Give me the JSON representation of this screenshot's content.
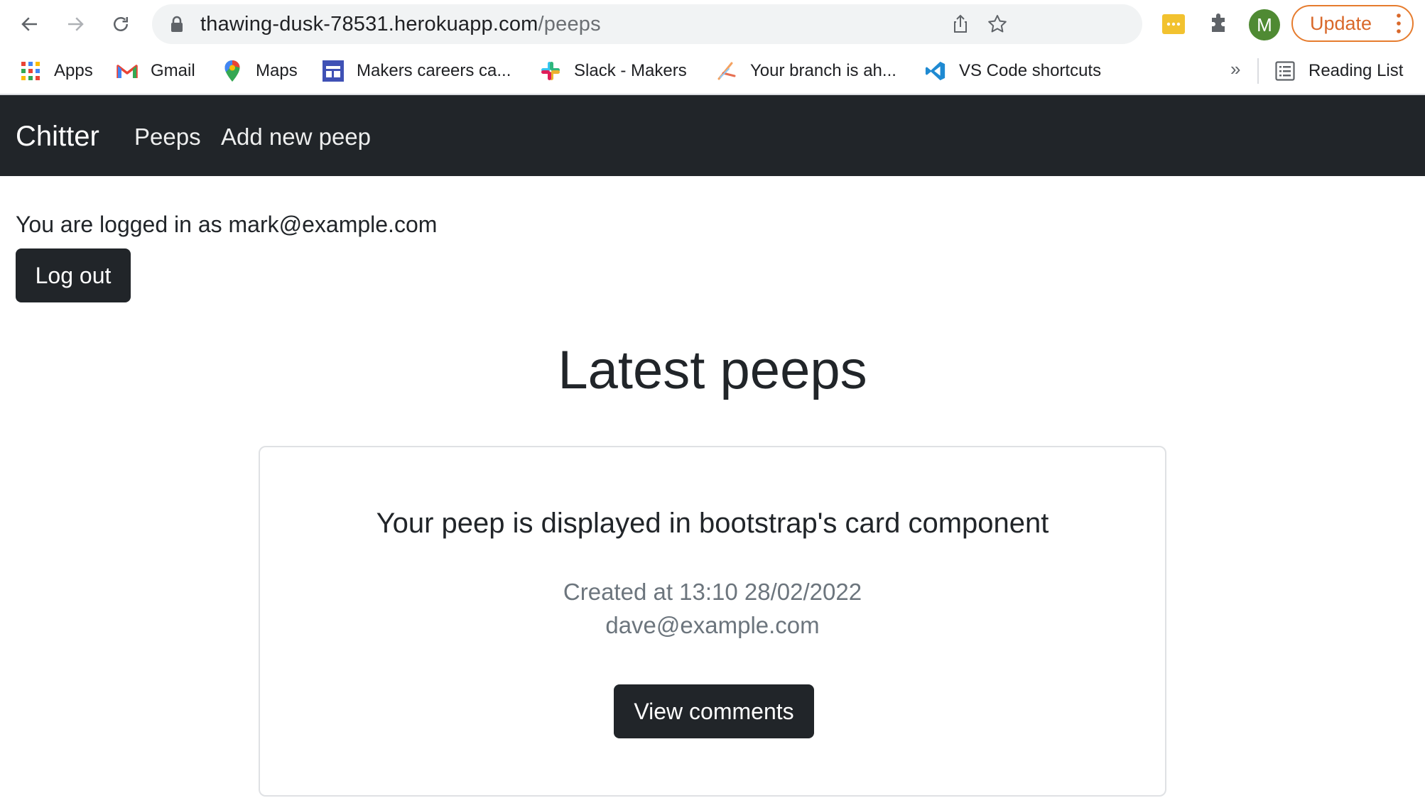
{
  "browser": {
    "url_host": "thawing-dusk-78531.herokuapp.com",
    "url_path": "/peeps",
    "avatar_initial": "M",
    "update_label": "Update",
    "bookmarks": [
      {
        "label": "Apps",
        "icon": "apps-grid-icon"
      },
      {
        "label": "Gmail",
        "icon": "gmail-icon"
      },
      {
        "label": "Maps",
        "icon": "maps-pin-icon"
      },
      {
        "label": "Makers careers ca...",
        "icon": "calendar-icon"
      },
      {
        "label": "Slack - Makers",
        "icon": "slack-icon"
      },
      {
        "label": "Your branch is ah...",
        "icon": "branch-icon"
      },
      {
        "label": "VS Code shortcuts",
        "icon": "vscode-icon"
      }
    ],
    "more_bookmarks": "»",
    "reading_list": "Reading List"
  },
  "navbar": {
    "brand": "Chitter",
    "links": [
      "Peeps",
      "Add new peep"
    ]
  },
  "session": {
    "logged_in_text": "You are logged in as mark@example.com",
    "logout_label": "Log out"
  },
  "main": {
    "title": "Latest peeps",
    "peeps": [
      {
        "text": "Your peep is displayed in bootstrap's card component",
        "created": "Created at 13:10 28/02/2022",
        "author": "dave@example.com",
        "button": "View comments"
      }
    ]
  },
  "colors": {
    "navbar_bg": "#212529",
    "button_bg": "#212529",
    "muted_text": "#6c757d",
    "update_accent": "#e67c2e",
    "avatar_bg": "#4f8a33"
  }
}
